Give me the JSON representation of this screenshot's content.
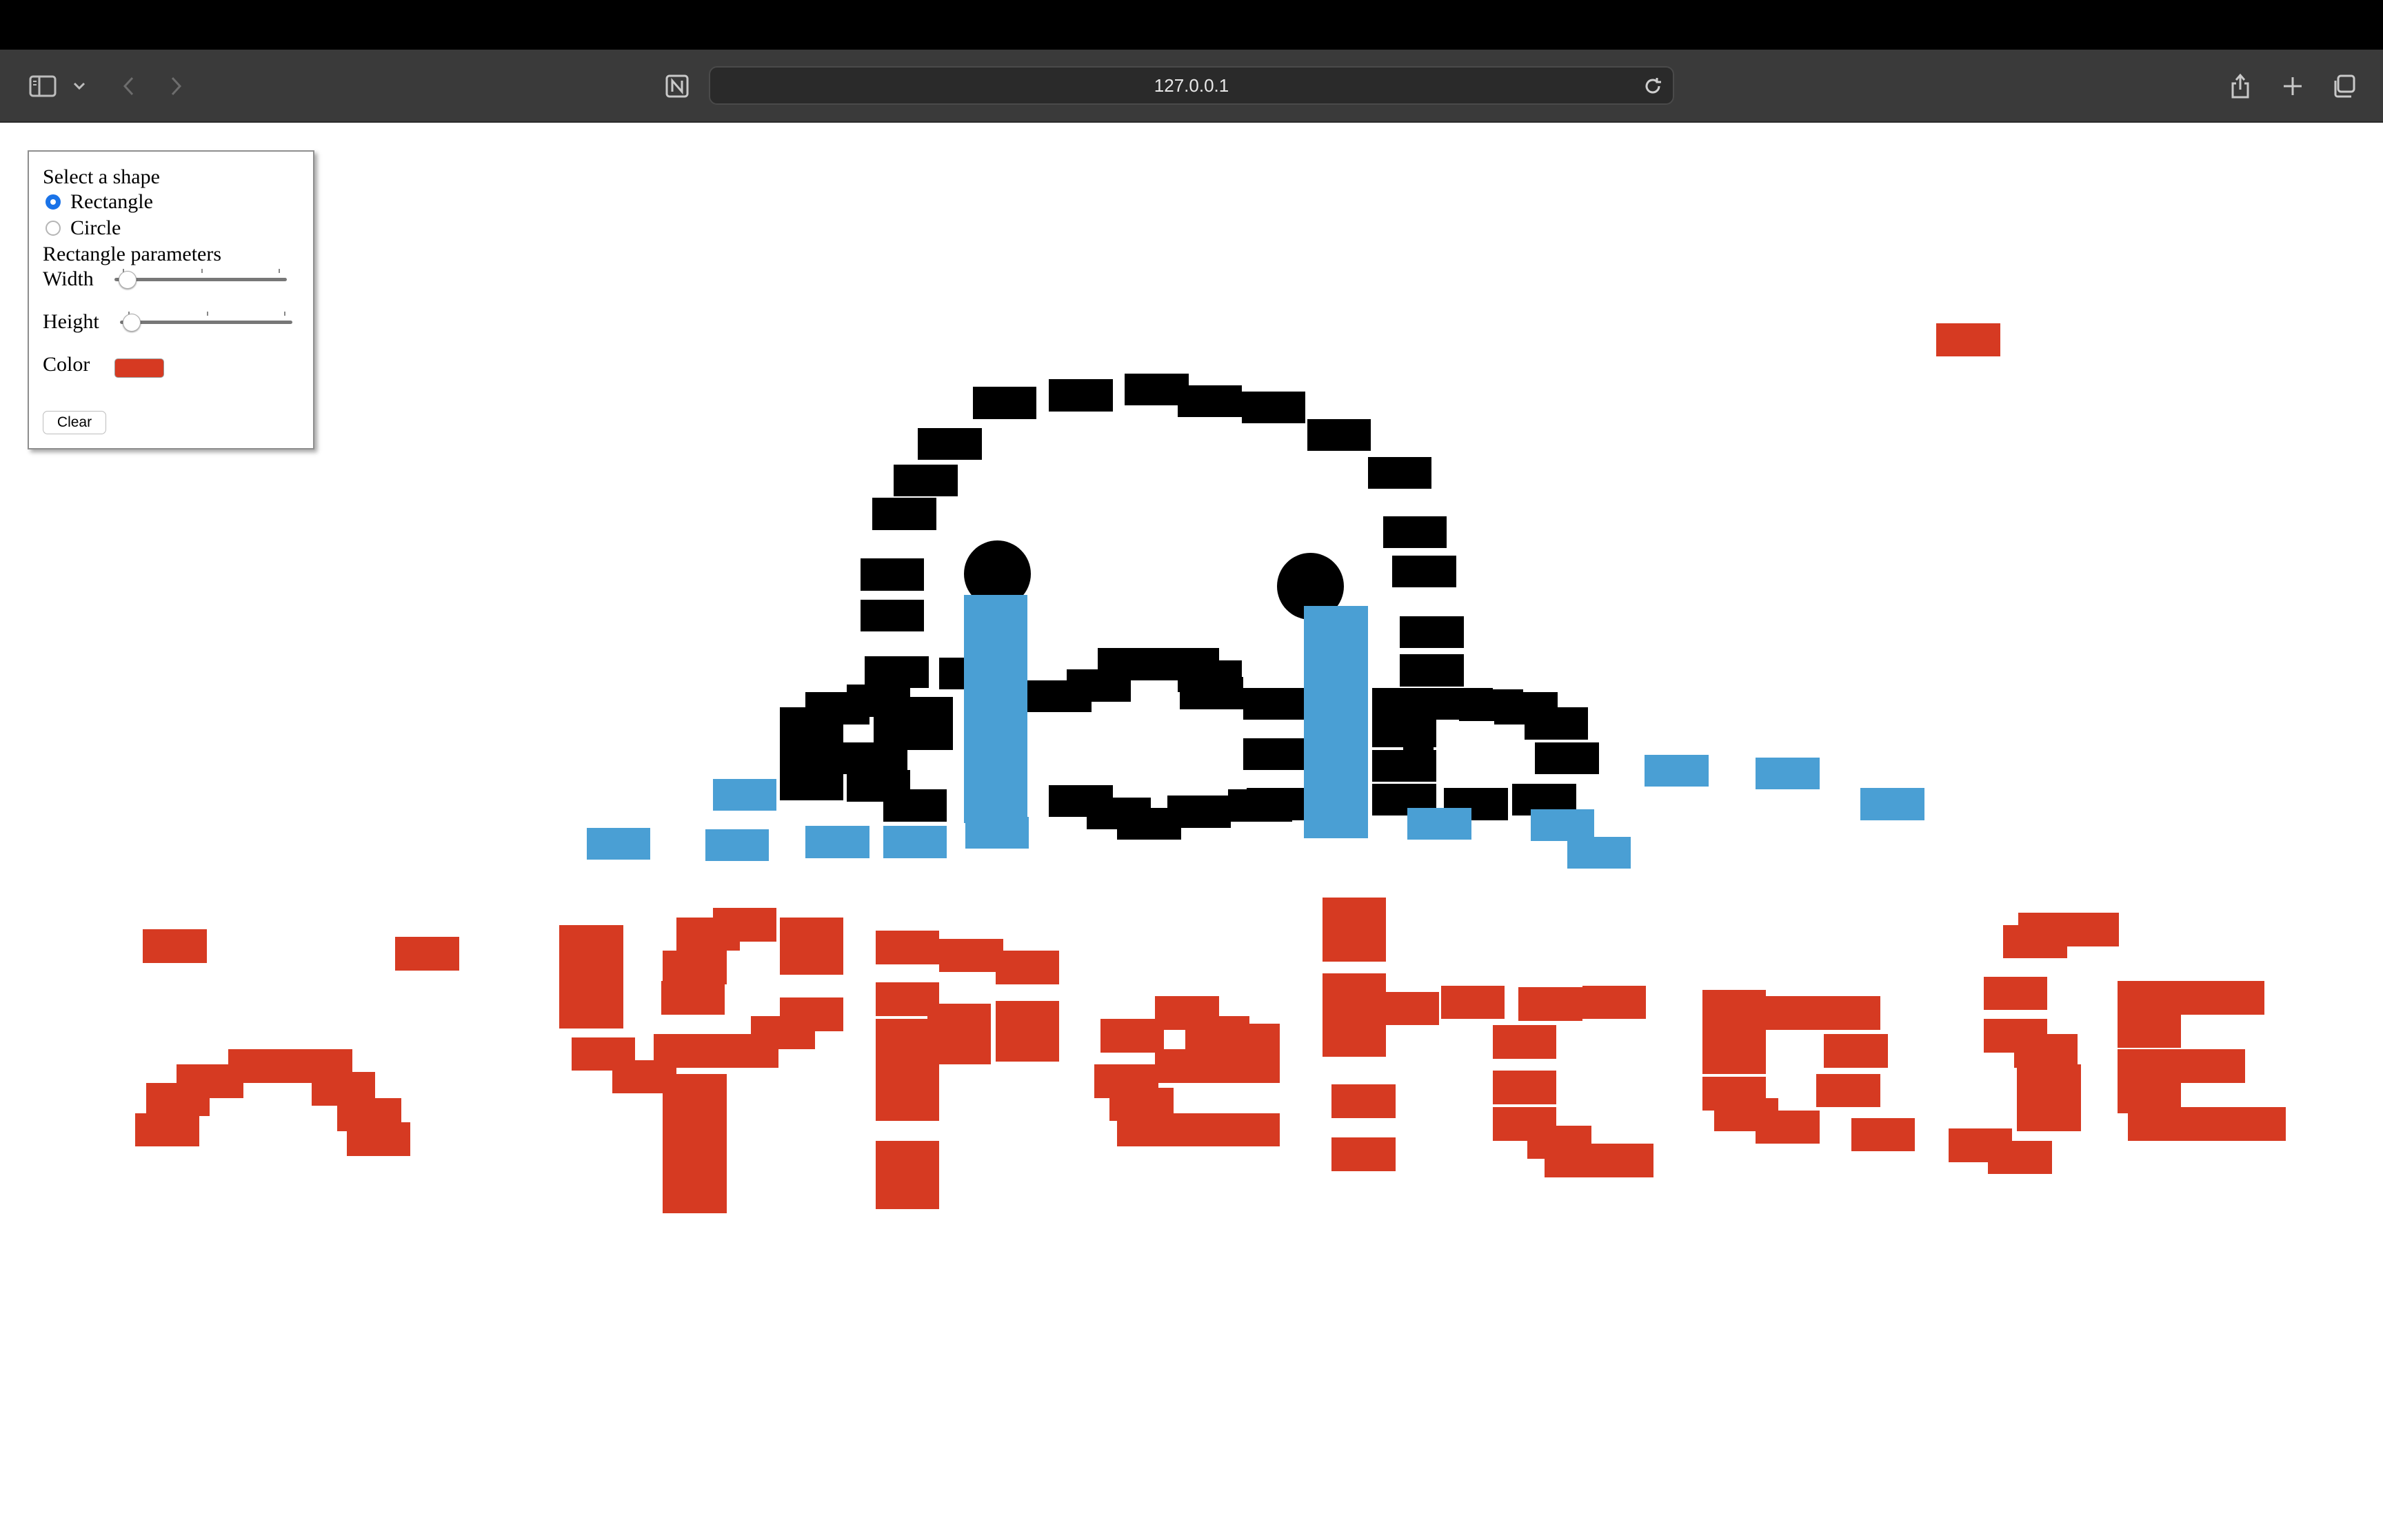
{
  "browser": {
    "url": "127.0.0.1"
  },
  "panel": {
    "title": "Select a shape",
    "options": [
      {
        "label": "Rectangle",
        "selected": true
      },
      {
        "label": "Circle",
        "selected": false
      }
    ],
    "params_heading": "Rectangle parameters",
    "width_label": "Width",
    "height_label": "Height",
    "color_label": "Color",
    "color_value": "#d63a22",
    "clear_label": "Clear"
  },
  "colors": {
    "red": "#d63a22",
    "blue": "#4a9fd4",
    "black": "#000000"
  }
}
